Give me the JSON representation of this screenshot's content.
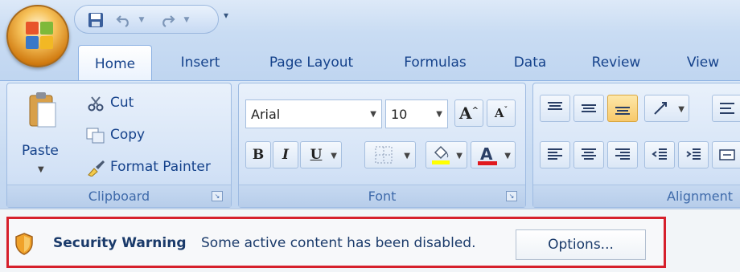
{
  "tabs": [
    {
      "label": "Home",
      "active": true
    },
    {
      "label": "Insert"
    },
    {
      "label": "Page Layout"
    },
    {
      "label": "Formulas"
    },
    {
      "label": "Data"
    },
    {
      "label": "Review"
    },
    {
      "label": "View"
    }
  ],
  "clipboard": {
    "paste_label": "Paste",
    "cut_label": "Cut",
    "copy_label": "Copy",
    "format_painter_label": "Format Painter",
    "group_label": "Clipboard"
  },
  "font": {
    "font_name": "Arial",
    "font_size": "10",
    "bold_label": "B",
    "italic_label": "I",
    "underline_label": "U",
    "group_label": "Font",
    "highlight_color": "#ffff00",
    "font_color": "#e0191f"
  },
  "alignment": {
    "group_label": "Alignment"
  },
  "security": {
    "title": "Security Warning",
    "message": "Some active content has been disabled.",
    "options_label": "Options...",
    "border_color": "#d6202c"
  },
  "icons": [
    "office-logo-icon",
    "save-icon",
    "undo-icon",
    "redo-icon",
    "paste-icon",
    "scissors-icon",
    "copy-icon",
    "paintbrush-icon",
    "shield-icon"
  ]
}
